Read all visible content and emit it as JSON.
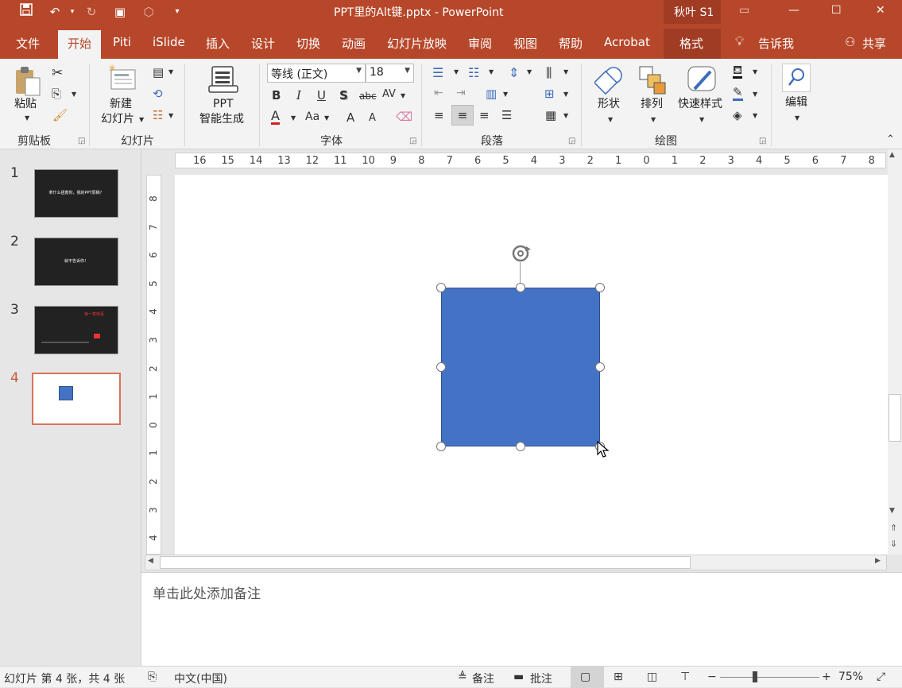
{
  "titlebar": {
    "doc_title": "PPT里的Alt键.pptx  -  PowerPoint",
    "context_label": "秋叶 S1",
    "min": "—",
    "max": "☐",
    "close": "✕"
  },
  "tabs": [
    "文件",
    "开始",
    "Piti",
    "iSlide",
    "插入",
    "设计",
    "切换",
    "动画",
    "幻灯片放映",
    "审阅",
    "视图",
    "帮助",
    "Acrobat",
    "格式"
  ],
  "tell_me": "告诉我",
  "share": "共享",
  "ribbon": {
    "groups": {
      "clipboard": "剪贴板",
      "slides": "幻灯片",
      "font": "字体",
      "paragraph": "段落",
      "drawing": "绘图"
    },
    "paste": "粘贴",
    "new_slide_1": "新建",
    "new_slide_2": "幻灯片",
    "ppt_gen_1": "PPT",
    "ppt_gen_2": "智能生成",
    "font_name": "等线 (正文)",
    "font_size": "18",
    "bold": "B",
    "italic": "I",
    "underline": "U",
    "shadow": "S",
    "strike": "abc",
    "spacing": "AV",
    "font_color": "A",
    "case": "Aa",
    "grow": "A",
    "shrink": "A",
    "shapes": "形状",
    "arrange": "排列",
    "quick_styles": "快速样式",
    "edit": "编辑"
  },
  "slides": [
    {
      "num": "1",
      "text": "拿什么拯救你，我的PPT原稿？"
    },
    {
      "num": "2",
      "text": "就不告诉你！"
    },
    {
      "num": "3",
      "text": "第一季惊喜"
    },
    {
      "num": "4",
      "text": ""
    }
  ],
  "rulers": {
    "h": [
      "16",
      "15",
      "14",
      "13",
      "12",
      "11",
      "10",
      "9",
      "8",
      "7",
      "6",
      "5",
      "4",
      "3",
      "2",
      "1",
      "0",
      "1",
      "2",
      "3",
      "4",
      "5",
      "6",
      "7",
      "8"
    ],
    "v": [
      "8",
      "7",
      "6",
      "5",
      "4",
      "3",
      "2",
      "1",
      "0",
      "1",
      "2",
      "3",
      "4"
    ]
  },
  "notes_placeholder": "单击此处添加备注",
  "status": {
    "slide_info": "幻灯片 第 4 张，共 4 张",
    "language": "中文(中国)",
    "notes": "备注",
    "comments": "批注",
    "zoom": "75%",
    "minus": "−",
    "plus": "+"
  },
  "colors": {
    "accent": "#b7472a",
    "shape_fill": "#4472c4"
  }
}
